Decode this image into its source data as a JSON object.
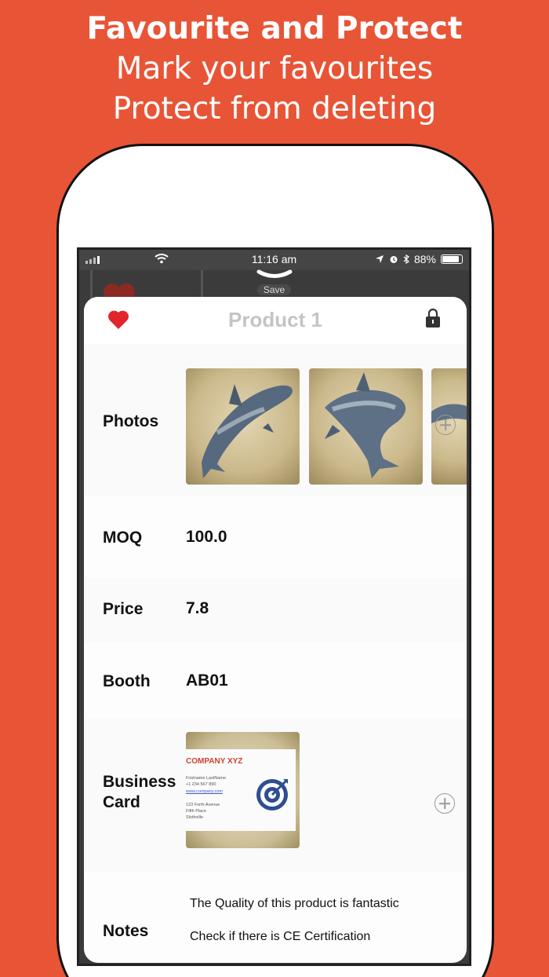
{
  "headline": {
    "title": "Favourite and Protect",
    "line1": "Mark your favourites",
    "line2": "Protect from deleting"
  },
  "status_bar": {
    "time": "11:16 am",
    "battery_percent": "88%",
    "battery_level": 0.88
  },
  "top_control": {
    "save_label": "Save"
  },
  "sheet": {
    "title": "Product 1",
    "favourite_icon": "heart-icon",
    "favourite_color": "#e0252b",
    "lock_icon": "lock-icon"
  },
  "fields": {
    "photos_label": "Photos",
    "moq_label": "MOQ",
    "moq_value": "100.0",
    "price_label": "Price",
    "price_value": "7.8",
    "booth_label": "Booth",
    "booth_value": "AB01",
    "business_card_label_1": "Business",
    "business_card_label_2": "Card",
    "notes_label": "Notes",
    "notes_line1": "The Quality of this product is fantastic",
    "notes_line2": "Check if there is CE Certification"
  },
  "business_card": {
    "company": "COMPANY XYZ",
    "name": "Firstname   LastName",
    "phone": "+1 234 567 890",
    "web": "www.company.com",
    "addr1": "123 Forth Avenue",
    "addr2": "Fifth Place",
    "addr3": "Slothville"
  }
}
